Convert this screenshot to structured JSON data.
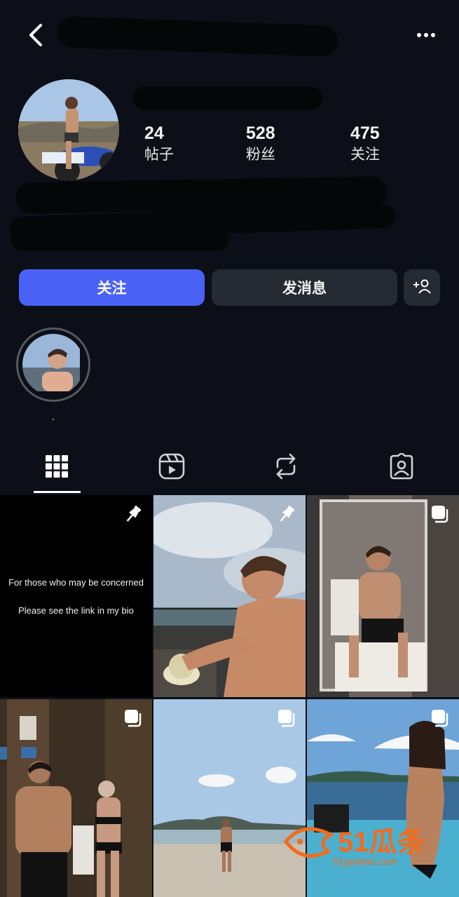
{
  "profile": {
    "stats": [
      {
        "value": "24",
        "label": "帖子"
      },
      {
        "value": "528",
        "label": "粉丝"
      },
      {
        "value": "475",
        "label": "关注"
      }
    ]
  },
  "actions": {
    "follow_label": "关注",
    "message_label": "发消息"
  },
  "highlight": {
    "label": "."
  },
  "tabs": [
    {
      "icon": "grid-icon",
      "selected": true
    },
    {
      "icon": "reels-icon",
      "selected": false
    },
    {
      "icon": "reposts-icon",
      "selected": false
    },
    {
      "icon": "tagged-icon",
      "selected": false
    }
  ],
  "posts": [
    {
      "type": "text",
      "line1": "For those who may be concerned",
      "line2": "Please see the link in my bio",
      "badge": "pin-icon"
    },
    {
      "type": "photo",
      "badge": "pin-icon"
    },
    {
      "type": "photo",
      "badge": "carousel-icon"
    },
    {
      "type": "photo",
      "badge": "carousel-icon"
    },
    {
      "type": "photo",
      "badge": "carousel-icon"
    },
    {
      "type": "photo",
      "badge": "carousel-icon"
    }
  ],
  "watermark": {
    "brand": "51瓜条",
    "url": "51guatiao.com"
  },
  "colors": {
    "background": "#0c0f17",
    "accent": "#4a62f5",
    "button_secondary": "#262a33",
    "watermark": "#f26b1d"
  }
}
